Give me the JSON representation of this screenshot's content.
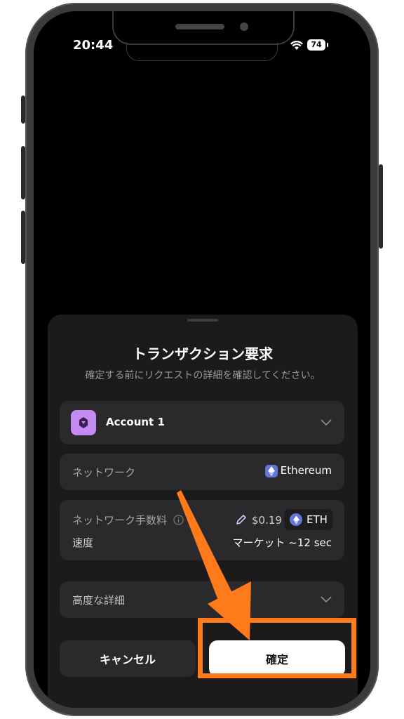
{
  "status_bar": {
    "time": "20:44",
    "battery": "74"
  },
  "sheet": {
    "title": "トランザクション要求",
    "subtitle": "確定する前にリクエストの詳細を確認してください。"
  },
  "account": {
    "name": "Account 1",
    "icon": "account-logo-icon"
  },
  "network": {
    "label": "ネットワーク",
    "value": "Ethereum"
  },
  "fee": {
    "label": "ネットワーク手数料",
    "amount": "$0.19",
    "token": "ETH",
    "speed_label": "速度",
    "speed_value": "マーケット ~12 sec"
  },
  "advanced": {
    "label": "高度な詳細"
  },
  "buttons": {
    "cancel": "キャンセル",
    "confirm": "確定"
  },
  "colors": {
    "accent_annotation": "#ff7a1a",
    "account_icon_bg": "#c48cf2",
    "eth_blue": "#6277d9"
  }
}
